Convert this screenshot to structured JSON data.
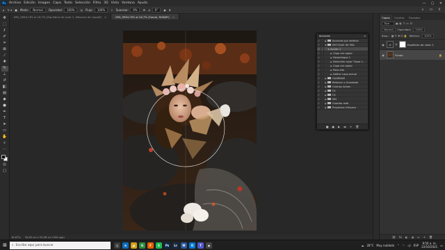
{
  "menubar": {
    "app_logo": "Ps",
    "items": [
      "Archivo",
      "Edición",
      "Imagen",
      "Capa",
      "Texto",
      "Selección",
      "Filtro",
      "3D",
      "Vista",
      "Ventana",
      "Ayuda"
    ],
    "window_controls": [
      "—",
      "▢",
      "✕"
    ]
  },
  "options": {
    "mode_label": "Modo:",
    "mode_value": "Normal",
    "opacity_label": "Opacidad:",
    "opacity_value": "100%",
    "flow_label": "Flujo:",
    "flow_value": "100%",
    "smoothing_label": "Suavizar:",
    "smoothing_value": "0%",
    "angle_value": "0°"
  },
  "tabs": [
    {
      "label": "IMG_9994.CR2 al 16,7% (Equilibrio de color 1, Máscara de capa/8)",
      "close": "×"
    },
    {
      "label": "IMG_9994.CR2 al 16,7% (Fondo, RGB/8*)",
      "close": "×"
    }
  ],
  "tools": [
    "move-icon",
    "marquee-icon",
    "lasso-icon",
    "quick-select-icon",
    "crop-icon",
    "frame-icon",
    "eyedropper-icon",
    "healing-icon",
    "brush-icon",
    "stamp-icon",
    "history-brush-icon",
    "eraser-icon",
    "gradient-icon",
    "blur-icon",
    "dodge-icon",
    "pen-icon",
    "type-icon",
    "path-select-icon",
    "rectangle-icon",
    "hand-icon",
    "zoom-icon",
    "more-icon"
  ],
  "statusbar": {
    "zoom": "16,67%",
    "doc_info": "35,65 cm x 53,48 cm (300 ppp)"
  },
  "actions_panel": {
    "title": "Acciones",
    "menu": "≡",
    "rows": [
      {
        "label": "Acciones por defecto",
        "indent": 1,
        "folder": true,
        "checked": true,
        "expanded": false,
        "selected": false
      },
      {
        "label": "RETOQUE DE PIEL",
        "indent": 1,
        "folder": true,
        "checked": true,
        "expanded": true,
        "selected": false
      },
      {
        "label": "Acción 1",
        "indent": 2,
        "folder": false,
        "checked": true,
        "expanded": true,
        "selected": true
      },
      {
        "label": "Capa vía copiar",
        "indent": 3,
        "folder": false,
        "checked": true,
        "expanded": false,
        "selected": false
      },
      {
        "label": "Desenfoque 1",
        "indent": 3,
        "folder": false,
        "checked": true,
        "expanded": false,
        "selected": false
      },
      {
        "label": "Selección capa \"Capa 1...",
        "indent": 3,
        "folder": false,
        "checked": true,
        "expanded": false,
        "selected": false
      },
      {
        "label": "Capa vía copiar",
        "indent": 3,
        "folder": false,
        "checked": true,
        "expanded": false,
        "selected": false
      },
      {
        "label": "Paso alto",
        "indent": 3,
        "folder": false,
        "checked": true,
        "expanded": false,
        "selected": false
      },
      {
        "label": "Definir capa actual",
        "indent": 3,
        "folder": false,
        "checked": true,
        "expanded": false,
        "selected": false
      },
      {
        "label": "GUARDAR",
        "indent": 1,
        "folder": true,
        "checked": true,
        "expanded": false,
        "selected": false
      },
      {
        "label": "Reforzar y Guardado",
        "indent": 1,
        "folder": true,
        "checked": true,
        "expanded": false,
        "selected": false
      },
      {
        "label": "Overlay Action",
        "indent": 1,
        "folder": true,
        "checked": true,
        "expanded": false,
        "selected": false
      },
      {
        "label": "FX",
        "indent": 1,
        "folder": true,
        "checked": true,
        "expanded": false,
        "selected": false
      },
      {
        "label": "FX",
        "indent": 1,
        "folder": true,
        "checked": true,
        "expanded": false,
        "selected": false
      },
      {
        "label": "WO",
        "indent": 1,
        "folder": true,
        "checked": true,
        "expanded": false,
        "selected": false
      },
      {
        "label": "Guardar web",
        "indent": 1,
        "folder": true,
        "checked": true,
        "expanded": false,
        "selected": false
      },
      {
        "label": "Proyectos Ortiyaca",
        "indent": 1,
        "folder": true,
        "checked": true,
        "expanded": false,
        "selected": false
      }
    ],
    "footer": [
      "■",
      "●",
      "▶",
      "▬",
      "+",
      "🗑"
    ]
  },
  "layers_panel": {
    "tabs": [
      "Capas",
      "Canales",
      "Trazados"
    ],
    "kind_label": "Tipo",
    "blend_mode": "Normal",
    "opacity_label": "Opacidad:",
    "opacity_value": "100%",
    "lock_label": "Bloq.:",
    "fill_label": "Relleno:",
    "fill_value": "100%",
    "layers": [
      {
        "name": "Equilibrio de color 1",
        "type": "adjustment"
      },
      {
        "name": "Fondo",
        "type": "image"
      }
    ],
    "footer": [
      "⛓",
      "fx",
      "◐",
      "◑",
      "▭",
      "+",
      "🗑"
    ]
  },
  "taskbar": {
    "search_placeholder": "Escribe aquí para buscar",
    "apps": [
      {
        "label": "◫",
        "color": "#3a3a3a"
      },
      {
        "label": "e",
        "color": "#0f6cbd"
      },
      {
        "label": "▦",
        "color": "#d4a017"
      },
      {
        "label": "G",
        "color": "#2d8c3e"
      },
      {
        "label": "F",
        "color": "#e66000"
      },
      {
        "label": "S",
        "color": "#1db954"
      },
      {
        "label": "Ps",
        "color": "#0b2a4a"
      },
      {
        "label": "Lr",
        "color": "#1a2a44"
      },
      {
        "label": "W",
        "color": "#2b579a"
      },
      {
        "label": "O",
        "color": "#0078d4"
      },
      {
        "label": "T",
        "color": "#5059c9"
      },
      {
        "label": "◉",
        "color": "#444444"
      }
    ],
    "weather_temp": "28°C",
    "weather_text": "Muy nublado",
    "language": "ESP",
    "time": "9:50 a. m.",
    "date": "22/10/2021"
  }
}
